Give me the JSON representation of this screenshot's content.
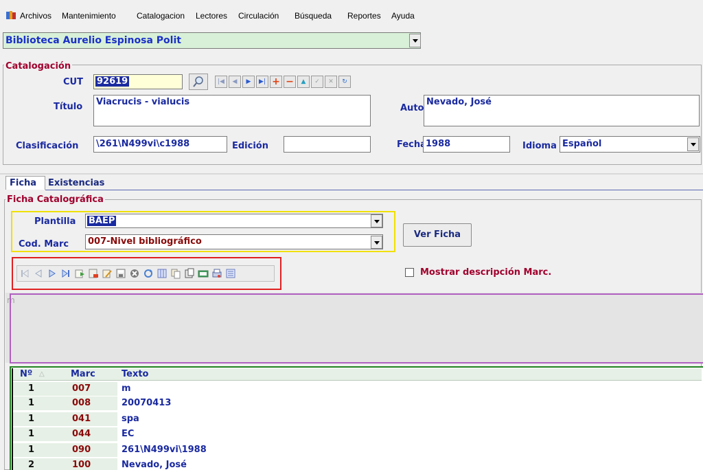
{
  "menu": {
    "items": [
      "Archivos",
      "Mantenimiento",
      "Catalogacion",
      "Lectores",
      "Circulación",
      "Búsqueda",
      "Reportes",
      "Ayuda"
    ]
  },
  "library": {
    "selected": "Biblioteca Aurelio Espinosa Polit"
  },
  "catalogacion": {
    "title": "Catalogación",
    "cut_label": "CUT",
    "cut_value": "92619",
    "titulo_label": "Título",
    "titulo_value": "Viacrucis - vialucis",
    "autor_label": "Autor",
    "autor_value": "Nevado, José",
    "clasificacion_label": "Clasificación",
    "clasificacion_value": "\\261\\N499vi\\c1988",
    "edicion_label": "Edición",
    "edicion_value": "",
    "fecha_label": "Fecha",
    "fecha_value": "1988",
    "idioma_label": "Idioma",
    "idioma_value": "Español"
  },
  "tabs": [
    "Ficha",
    "Existencias"
  ],
  "ficha": {
    "title": "Ficha Catalográfica",
    "plantilla_label": "Plantilla",
    "plantilla_value": "BAEP",
    "codmarc_label": "Cod. Marc",
    "codmarc_value": "007-Nivel bibliográfico",
    "ver_ficha_label": "Ver Ficha",
    "mostrar_label": "Mostrar descripción Marc.",
    "editor_text": "m"
  },
  "colors": {
    "label_blue": "#1a2aa0",
    "accent_red": "#a0002d",
    "highlight_yellow": "#f0e000",
    "highlight_red": "#e02020",
    "highlight_purple": "#b060c0",
    "highlight_green": "#208020"
  },
  "grid": {
    "headers": [
      "Nº",
      "Marc",
      "Texto"
    ],
    "rows": [
      {
        "n": "1",
        "marc": "007",
        "texto": "m"
      },
      {
        "n": "1",
        "marc": "008",
        "texto": "20070413"
      },
      {
        "n": "1",
        "marc": "041",
        "texto": "spa"
      },
      {
        "n": "1",
        "marc": "044",
        "texto": "EC"
      },
      {
        "n": "1",
        "marc": "090",
        "texto": "261\\N499vi\\1988"
      },
      {
        "n": "2",
        "marc": "100",
        "texto": "Nevado, José"
      }
    ]
  }
}
